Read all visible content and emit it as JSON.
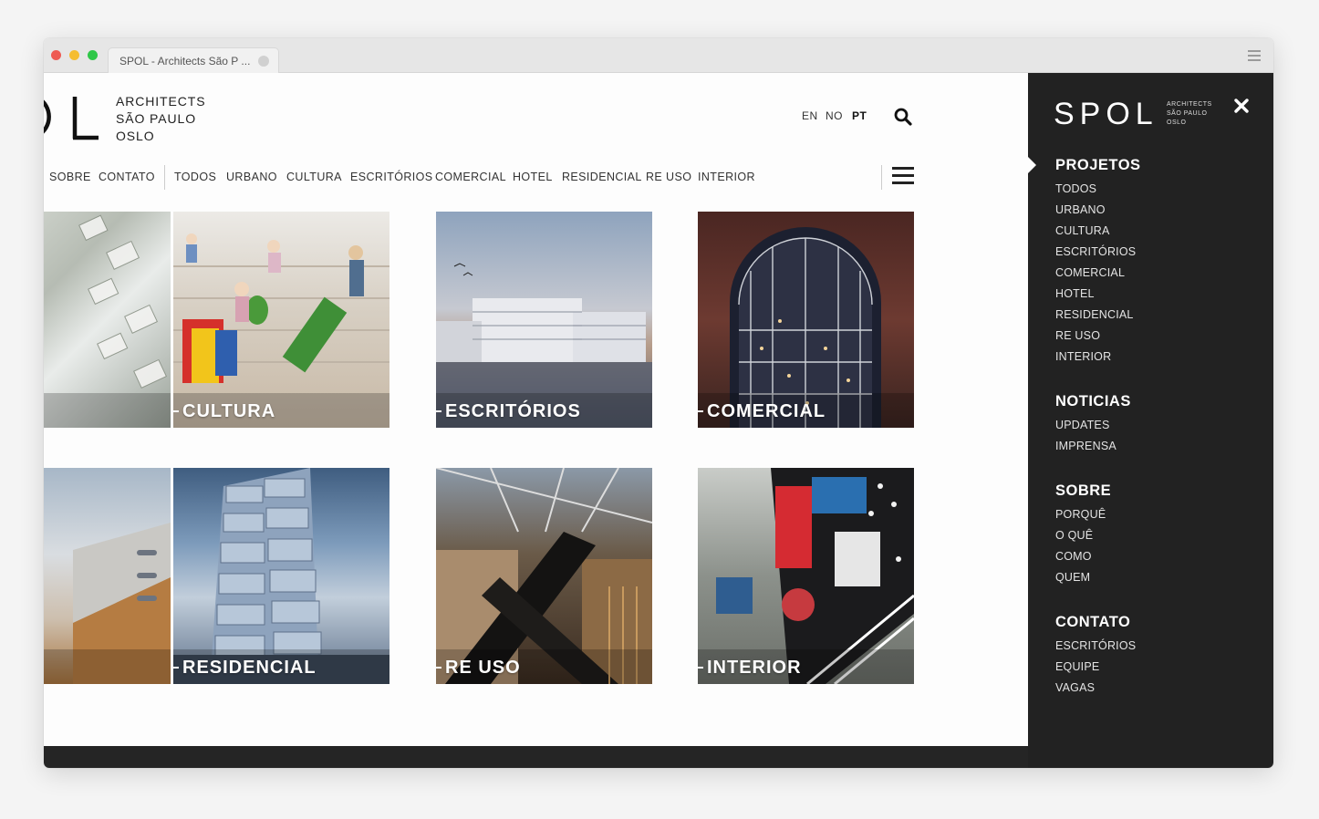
{
  "browser": {
    "tab_title": "SPOL - Architects São P ..."
  },
  "header": {
    "logo_lines": [
      "ARCHITECTS",
      "SÃO PAULO",
      "OSLO"
    ],
    "languages": [
      "EN",
      "NO",
      "PT"
    ],
    "active_language": "PT"
  },
  "nav": {
    "items": [
      "SOBRE",
      "CONTATO",
      "TODOS",
      "URBANO",
      "CULTURA",
      "ESCRITÓRIOS",
      "COMERCIAL",
      "HOTEL",
      "RESIDENCIAL",
      "RE USO",
      "INTERIOR"
    ]
  },
  "tiles": {
    "row1": [
      "CULTURA",
      "ESCRITÓRIOS",
      "COMERCIAL"
    ],
    "row2": [
      "RESIDENCIAL",
      "RE USO",
      "INTERIOR"
    ]
  },
  "sidebar": {
    "logo": "SPOL",
    "logo_sub": [
      "ARCHITECTS",
      "SÃO PAULO",
      "OSLO"
    ],
    "sections": [
      {
        "title": "PROJETOS",
        "links": [
          "TODOS",
          "URBANO",
          "CULTURA",
          "ESCRITÓRIOS",
          "COMERCIAL",
          "HOTEL",
          "RESIDENCIAL",
          "RE USO",
          "INTERIOR"
        ]
      },
      {
        "title": "NOTICIAS",
        "links": [
          "UPDATES",
          "IMPRENSA"
        ]
      },
      {
        "title": "SOBRE",
        "links": [
          "PORQUÊ",
          "O QUÊ",
          "COMO",
          "QUEM"
        ]
      },
      {
        "title": "CONTATO",
        "links": [
          "ESCRITÓRIOS",
          "EQUIPE",
          "VAGAS"
        ]
      }
    ]
  },
  "icons": [
    "search-icon",
    "hamburger-menu-icon",
    "close-icon",
    "window-menu-icon"
  ],
  "colors": {
    "sidebar_bg": "#222222",
    "page_bg": "#fdfdfd",
    "text": "#222222"
  }
}
